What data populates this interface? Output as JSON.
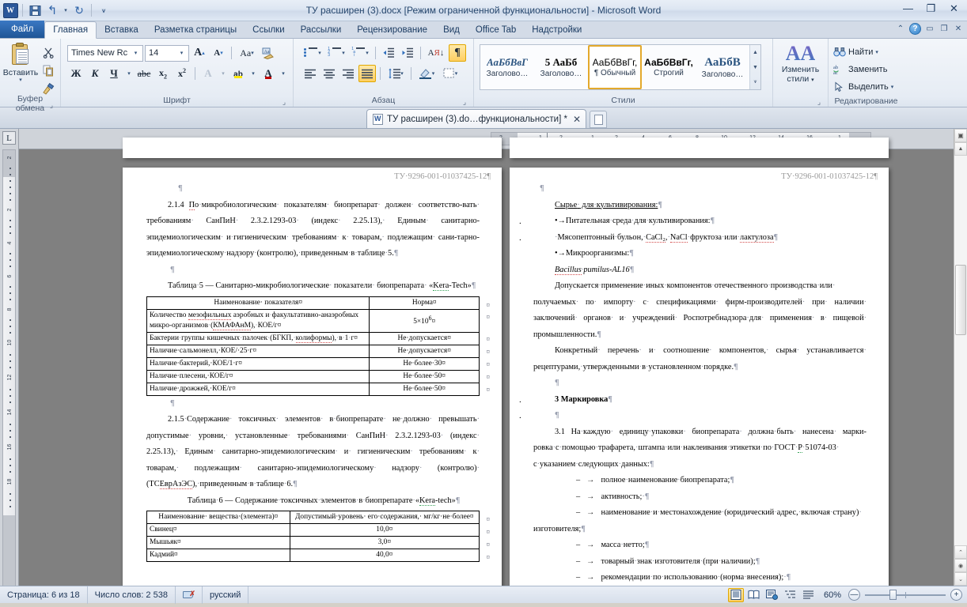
{
  "window": {
    "title": "ТУ расширен (3).docx [Режим ограниченной функциональности]  -  Microsoft Word",
    "minimize": "—",
    "restore": "❐",
    "close": "✕"
  },
  "quick_access": {
    "app_icon": "W",
    "save_label": "save-icon",
    "undo_label": "↰",
    "redo_label": "↻",
    "customize_label": "▾"
  },
  "ribbon_tabs": [
    {
      "label": "Файл",
      "active": false,
      "file": true
    },
    {
      "label": "Главная",
      "active": true,
      "file": false
    },
    {
      "label": "Вставка",
      "active": false,
      "file": false
    },
    {
      "label": "Разметка страницы",
      "active": false,
      "file": false
    },
    {
      "label": "Ссылки",
      "active": false,
      "file": false
    },
    {
      "label": "Рассылки",
      "active": false,
      "file": false
    },
    {
      "label": "Рецензирование",
      "active": false,
      "file": false
    },
    {
      "label": "Вид",
      "active": false,
      "file": false
    },
    {
      "label": "Office Tab",
      "active": false,
      "file": false
    },
    {
      "label": "Надстройки",
      "active": false,
      "file": false
    }
  ],
  "ribbon": {
    "clipboard": {
      "group_label": "Буфер обмена",
      "paste_label": "Вставить",
      "paste_arrow": "▾",
      "cut_label": "✂",
      "copy_label": "copy-icon",
      "format_painter_label": "format-painter-icon"
    },
    "font": {
      "group_label": "Шрифт",
      "font_name": "Times New Rc",
      "font_size": "14",
      "grow_font": "A",
      "shrink_font": "A",
      "change_case": "Aa",
      "clear_format": "clear-formatting-icon",
      "bold": "Ж",
      "italic": "К",
      "underline": "Ч",
      "strikethrough": "abc",
      "subscript": "x",
      "superscript": "x",
      "text_effects": "A",
      "highlight": "ab",
      "font_color": "A",
      "arrow": "▾"
    },
    "paragraph": {
      "group_label": "Абзац",
      "bullets": "bullets-icon",
      "numbering": "numbering-icon",
      "multilevel": "multilevel-list-icon",
      "decrease_indent": "decrease-indent-icon",
      "increase_indent": "increase-indent-icon",
      "sort": "sort-icon",
      "show_marks": "¶",
      "align_left": "align-left-icon",
      "align_center": "align-center-icon",
      "align_right": "align-right-icon",
      "justify": "justify-icon",
      "line_spacing": "line-spacing-icon",
      "shading": "shading-icon",
      "borders": "borders-icon",
      "arrow": "▾"
    },
    "styles": {
      "group_label": "Стили",
      "items": [
        {
          "preview": "АаБбВвГ",
          "name": "Заголово…",
          "selected": false,
          "style": "serif-italic-blue"
        },
        {
          "preview": "5  АаБб",
          "name": "Заголово…",
          "selected": false,
          "style": "serif-bold"
        },
        {
          "preview": "АаБбВвГг,",
          "name": "¶ Обычный",
          "selected": true,
          "style": "sans"
        },
        {
          "preview": "АаБбВвГг,",
          "name": "Строгий",
          "selected": false,
          "style": "sans-bold"
        },
        {
          "preview": "АаБбВ",
          "name": "Заголово…",
          "selected": false,
          "style": "serif-bold-blue"
        }
      ],
      "scroll_up": "▲",
      "scroll_down": "▼",
      "more": "▾"
    },
    "change_styles": {
      "group_label": "",
      "label_line1": "Изменить",
      "label_line2": "стили",
      "arrow": "▾",
      "icon": "АА"
    },
    "editing": {
      "group_label": "Редактирование",
      "find": "Найти",
      "find_arrow": "▾",
      "replace": "Заменить",
      "select": "Выделить",
      "select_arrow": "▾"
    }
  },
  "doc_tabs": {
    "active_tab_label": "ТУ расширен (3).do…функциональности] *",
    "close_icon": "✕",
    "new_tab_icon": "new-document-icon"
  },
  "rulers": {
    "tab_stop_marker": "L",
    "vertical_ticks": [
      "2",
      "2",
      "4",
      "6",
      "8",
      "10",
      "12",
      "14",
      "16",
      "18"
    ],
    "horizontal_ticks": [
      "2",
      "1",
      "2",
      "1",
      "2",
      "4",
      "6",
      "8",
      "10",
      "12",
      "14",
      "16",
      "1"
    ]
  },
  "document": {
    "left_page": {
      "header": "ТУ·9296-001-01037425-12¶",
      "blocks": [
        {
          "type": "pilcrow",
          "text": "¶"
        },
        {
          "type": "para",
          "text": "2.1.4 По·микробиологическим· показателям· биопрепарат· должен· соответство-вать· требованиям· СанПиН· 2.3.2.1293-03· (индекс· 2.25.13),· Единым· санитарно-эпидемиологическим· и·гигиеническим· требованиям· к· товарам,· подлежащим· сани-тарно-эпидемиологическому·надзору·(контролю),·приведенным·в·таблице·5.¶"
        },
        {
          "type": "pilcrow",
          "text": "¶"
        },
        {
          "type": "para",
          "text": "Таблица·5 — Санитарно-микробиологические· показатели· биопрепарата· «Kera-Tech»¶"
        }
      ],
      "table5": {
        "headers": [
          "Наименование· показателя¤",
          "Норма¤"
        ],
        "rows": [
          [
            "Количество мезофильных аэробных и·факультативно-анаэробных микро-организмов·(КМАФАнМ),·КОЕ/г¤",
            "5×10⁶¤"
          ],
          [
            "Бактерии·группы·кишечных·палочек·(БГКП,·колиформы),·в·1·г¤",
            "Не·допускается¤"
          ],
          [
            "Наличие·сальмонелл,·КОЕ/·25·г¤",
            "Не·допускается¤"
          ],
          [
            "Наличие·бактерий,·КОЕ/1·г¤",
            "Не·более·30¤"
          ],
          [
            "Наличие·плесени,·КОЕ/г¤",
            "Не·более·50¤"
          ],
          [
            "Наличие·дрожжей,·КОЕ/г¤",
            "Не·более·50¤"
          ]
        ],
        "row_mark": "¤"
      },
      "blocks2": [
        {
          "type": "pilcrow",
          "text": "¶"
        },
        {
          "type": "para",
          "text": "2.1.5·Содержание· токсичных· элементов· в·биопрепарате· не·должно· превышать· допустимые· уровни,· установленные· требованиями· СанПиН· 2.3.2.1293-03· (индекс· 2.25.13),· Единым· санитарно-эпидемиологическим· и· гигиеническим· требованиям· к· товарам,· подлежащим· санитарно-эпидемиологическому· надзору· (контролю)· (ТС ЕврАзЭС),·приведенным·в·таблице·6.¶"
        },
        {
          "type": "para",
          "text": "Таблица·6 — Содержание·токсичных·элементов·в·биопрепарате·«Kera-tech»¶"
        }
      ],
      "table6": {
        "headers": [
          "Наименование· вещества·(элемента)¤",
          "Допустимый·уровень· его·содержания,· мг/кг·не·более¤"
        ],
        "rows": [
          [
            "Свинец¤",
            "10,0¤"
          ],
          [
            "Мышьяк¤",
            "3,0¤"
          ],
          [
            "Кадмий¤",
            "40,0¤"
          ]
        ],
        "row_mark": "¤"
      }
    },
    "right_page": {
      "header": "ТУ·9296-001-01037425-12¶",
      "blocks": [
        {
          "type": "pilcrow",
          "text": "¶"
        },
        {
          "type": "underline-para",
          "text": "Сырье· для·культивирования:¶"
        },
        {
          "type": "bullet",
          "text": "•→Питательная·среда·для·культивирования:¶"
        },
        {
          "type": "bullet",
          "text": "·Мясопептонный·бульон,·CaCl₂,·NaCl·фруктоза·или·лактулоза¶"
        },
        {
          "type": "plain",
          "text": "•→Микроорганизмы:¶"
        },
        {
          "type": "italic",
          "text": "Bacillus·pumilus-AL16¶"
        },
        {
          "type": "para",
          "text": "Допускается·применение·иных·компонентов·отечественного·производства·или· получаемых· по· импорту· с· спецификациями· фирм-производителей· при· наличии· заключений· органов· и· учреждений· Роспотребнадзора· для· применения· в· пищевой· промышленности.¶"
        },
        {
          "type": "para",
          "text": "Конкретный· перечень· и· соотношение· компонентов,· сырья· устанавливается· рецептурами,·утвержденными·в·установленном·порядке.¶"
        },
        {
          "type": "pilcrow",
          "text": "¶"
        },
        {
          "type": "bold-bullet",
          "text": "3 Маркировка¶"
        },
        {
          "type": "bullet-pilcrow",
          "text": "¶"
        },
        {
          "type": "para",
          "text": "3.1 На·каждую· единицу·упаковки· биопрепарата· должна·быть· нанесена· марки-ровка·с·помощью·трафарета,·штампа·или·наклеивания·этикетки·по·ГОСТ·Р·51074-03· с·указанием·следующих·данных:¶"
        },
        {
          "type": "dash",
          "text": "полное·наименование·биопрепарата;¶"
        },
        {
          "type": "dash",
          "text": "активность;·¶"
        },
        {
          "type": "dash-wrap",
          "text": "наименование·и·местонахождение·(юридический·адрес,·включая·страну)·",
          "cont": "изготовителя;¶"
        },
        {
          "type": "dash",
          "text": "масса·нетто;¶"
        },
        {
          "type": "dash",
          "text": "товарный·знак·изготовителя·(при·наличии);¶"
        },
        {
          "type": "dash",
          "text": "рекомендации·по·использованию·(норма·внесения);·¶"
        }
      ]
    }
  },
  "status_bar": {
    "page": "Страница: 6 из 18",
    "words": "Число слов: 2 538",
    "language": "русский",
    "spell_icon": "spell-check-error-icon",
    "view_buttons": [
      {
        "name": "print-layout",
        "glyph": "print-layout-icon",
        "active": true
      },
      {
        "name": "full-screen-reading",
        "glyph": "reading-view-icon",
        "active": false
      },
      {
        "name": "web-layout",
        "glyph": "web-layout-icon",
        "active": false
      },
      {
        "name": "outline",
        "glyph": "outline-view-icon",
        "active": false
      },
      {
        "name": "draft",
        "glyph": "draft-view-icon",
        "active": false
      }
    ],
    "zoom": "60%",
    "zoom_out": "—",
    "zoom_in": "+"
  },
  "colors": {
    "accent": "#2b579a",
    "ribbon_bg": "#e6ecf4",
    "selection_gold": "#ffcf62",
    "page_bg": "#808080",
    "header_grey": "#9a9a9a",
    "spell_red": "#d34b4b",
    "grammar_green": "#3ba55c"
  }
}
